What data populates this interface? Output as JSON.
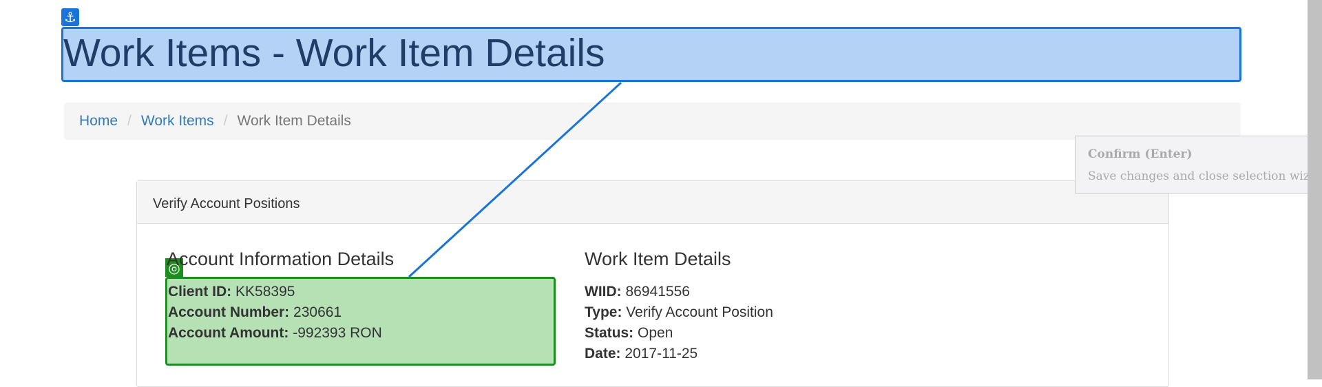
{
  "page": {
    "title": "Work Items - Work Item Details"
  },
  "breadcrumb": {
    "items": [
      "Home",
      "Work Items"
    ],
    "separator": "/",
    "current": "Work Item Details"
  },
  "panel": {
    "heading": "Verify Account Positions"
  },
  "account_info": {
    "title": "Account Information Details",
    "client_id_label": "Client ID:",
    "client_id": "KK58395",
    "account_number_label": "Account Number:",
    "account_number": "230661",
    "account_amount_label": "Account Amount:",
    "account_amount": "-992393 RON"
  },
  "work_item": {
    "title": "Work Item Details",
    "wiid_label": "WIID:",
    "wiid": "86941556",
    "type_label": "Type:",
    "type": "Verify Account Position",
    "status_label": "Status:",
    "status": "Open",
    "date_label": "Date:",
    "date": "2017-11-25"
  },
  "tooltip": {
    "title": "Confirm (Enter)",
    "description": "Save changes and close selection wizard."
  },
  "icons": {
    "anchor": "anchor-icon",
    "target": "target-icon"
  },
  "colors": {
    "selection_blue": "#1a73d9",
    "selection_green": "#1f8c1f",
    "link": "#337ab7"
  }
}
